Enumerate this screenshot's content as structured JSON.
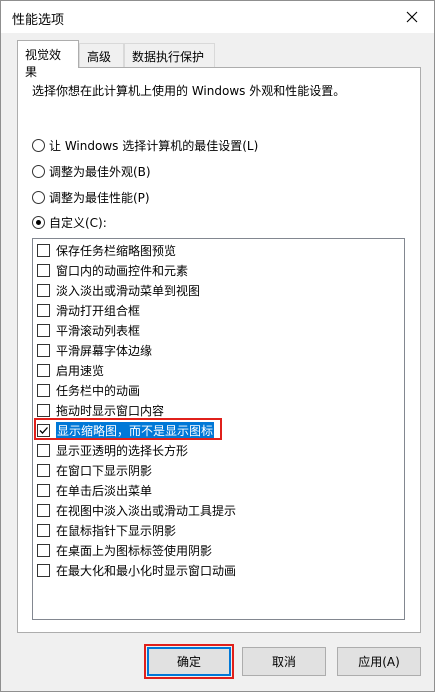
{
  "window": {
    "title": "性能选项"
  },
  "tabs": [
    {
      "label": "视觉效果",
      "selected": true
    },
    {
      "label": "高级",
      "selected": false
    },
    {
      "label": "数据执行保护",
      "selected": false
    }
  ],
  "visual_effects": {
    "description": "选择你想在此计算机上使用的 Windows 外观和性能设置。",
    "radios": [
      {
        "label": "让 Windows 选择计算机的最佳设置(L)",
        "checked": false
      },
      {
        "label": "调整为最佳外观(B)",
        "checked": false
      },
      {
        "label": "调整为最佳性能(P)",
        "checked": false
      },
      {
        "label": "自定义(C):",
        "checked": true
      }
    ],
    "options": [
      {
        "label": "保存任务栏缩略图预览",
        "checked": false
      },
      {
        "label": "窗口内的动画控件和元素",
        "checked": false
      },
      {
        "label": "淡入淡出或滑动菜单到视图",
        "checked": false
      },
      {
        "label": "滑动打开组合框",
        "checked": false
      },
      {
        "label": "平滑滚动列表框",
        "checked": false
      },
      {
        "label": "平滑屏幕字体边缘",
        "checked": false
      },
      {
        "label": "启用速览",
        "checked": false
      },
      {
        "label": "任务栏中的动画",
        "checked": false
      },
      {
        "label": "拖动时显示窗口内容",
        "checked": false
      },
      {
        "label": "显示缩略图，而不是显示图标",
        "checked": true,
        "selected": true
      },
      {
        "label": "显示亚透明的选择长方形",
        "checked": false
      },
      {
        "label": "在窗口下显示阴影",
        "checked": false
      },
      {
        "label": "在单击后淡出菜单",
        "checked": false
      },
      {
        "label": "在视图中淡入淡出或滑动工具提示",
        "checked": false
      },
      {
        "label": "在鼠标指针下显示阴影",
        "checked": false
      },
      {
        "label": "在桌面上为图标标签使用阴影",
        "checked": false
      },
      {
        "label": "在最大化和最小化时显示窗口动画",
        "checked": false
      }
    ]
  },
  "buttons": {
    "ok": "确定",
    "cancel": "取消",
    "apply": "应用(A)"
  },
  "colors": {
    "selection": "#0078d7",
    "annotation_red": "#e0201b"
  }
}
